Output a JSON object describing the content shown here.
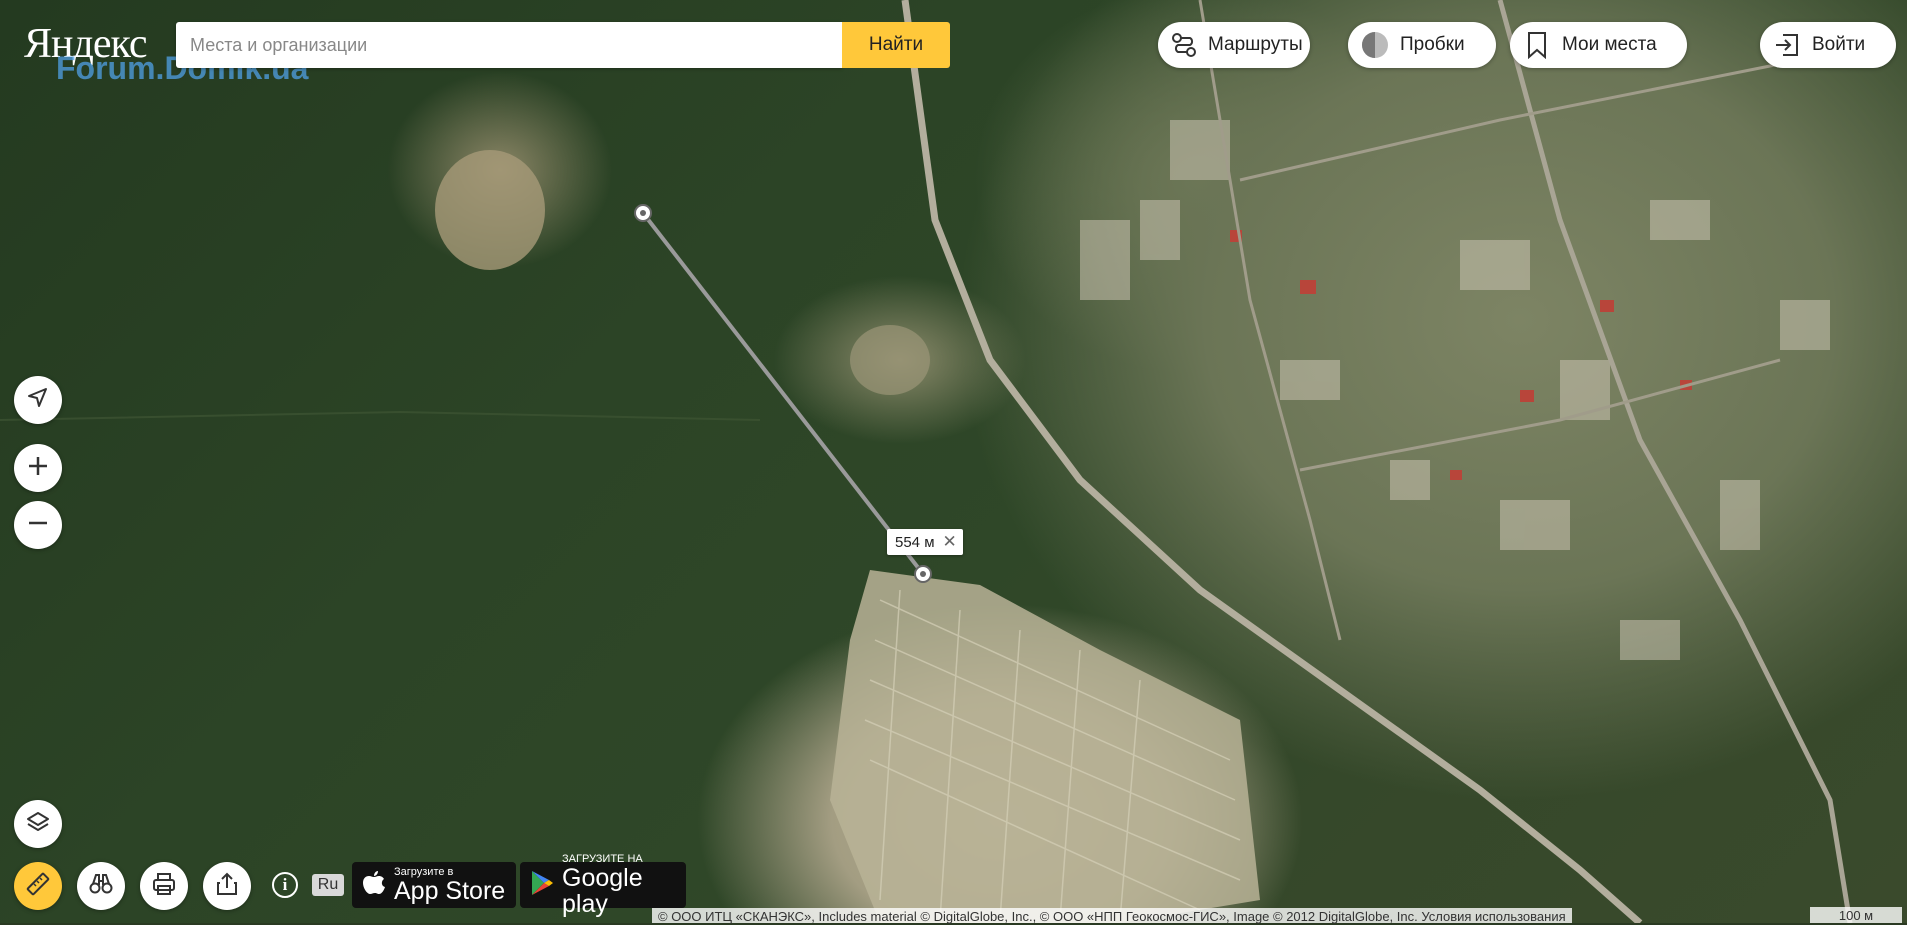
{
  "logo": {
    "text": "Яндекс",
    "watermark": "Forum.Domik.ua"
  },
  "search": {
    "placeholder": "Места и организации",
    "value": "",
    "button_label": "Найти"
  },
  "toolbar": {
    "routes_label": "Маршруты",
    "traffic_label": "Пробки",
    "my_places_label": "Мои места",
    "login_label": "Войти"
  },
  "map_controls": {
    "geolocation_icon": "location-arrow-icon",
    "zoom_in_icon": "plus-icon",
    "zoom_out_icon": "minus-icon",
    "layers_icon": "layers-icon",
    "ruler_icon": "ruler-icon",
    "panorama_icon": "binoculars-icon",
    "print_icon": "printer-icon",
    "share_icon": "share-icon"
  },
  "ruler": {
    "distance_label": "554 м",
    "close_icon": "close-icon"
  },
  "footer": {
    "info_label": "i",
    "language_label": "Ru",
    "app_store_small": "Загрузите в",
    "app_store_big": "App Store",
    "google_play_small": "ЗАГРУЗИТЕ НА",
    "google_play_big": "Google play",
    "copyright": "© ООО ИТЦ «СКАНЭКС», Includes material © DigitalGlobe, Inc., © ООО «НПП Геокосмос-ГИС», Image © 2012 DigitalGlobe, Inc. Условия использования",
    "scale_label": "100 м"
  },
  "colors": {
    "accent": "#ffc83a",
    "ruler_line": "#9a9a9a"
  }
}
